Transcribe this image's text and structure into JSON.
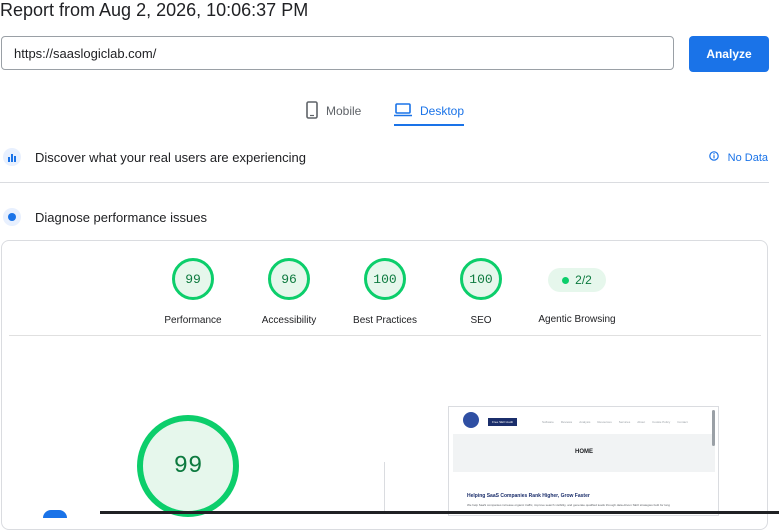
{
  "report": {
    "title": "Report from Aug 2, 2026, 10:06:37 PM"
  },
  "search": {
    "url": "https://saaslogiclab.com/",
    "analyze_label": "Analyze"
  },
  "device_tabs": {
    "mobile": "Mobile",
    "desktop": "Desktop",
    "selected": "Desktop"
  },
  "discover": {
    "label": "Discover what your real users are experiencing",
    "status": "No Data"
  },
  "diagnose": {
    "label": "Diagnose performance issues"
  },
  "scores": [
    {
      "label": "Performance",
      "value": "99"
    },
    {
      "label": "Accessibility",
      "value": "96"
    },
    {
      "label": "Best Practices",
      "value": "100"
    },
    {
      "label": "SEO",
      "value": "100"
    }
  ],
  "agentic": {
    "label": "Agentic Browsing",
    "value": "2/2"
  },
  "performance_detail": {
    "score": "99"
  },
  "screenshot": {
    "cta": "Free SEO Audit",
    "nav_links": [
      "Software",
      "Reviews",
      "Analysis",
      "Resources",
      "Services",
      "About",
      "Cookie Policy",
      "Contact"
    ],
    "hero_title": "HOME",
    "headline": "Helping SaaS Companies Rank Higher, Grow Faster",
    "body": "We help SaaS companies increase organic traffic, improve search visibility, and generate qualified leads through data-driven SEO strategies built for long"
  },
  "colors": {
    "accent": "#1a73e8",
    "pass": "#0cce6b",
    "pass_bg": "#e6f7ec",
    "pass_text": "#0d7a3f"
  }
}
